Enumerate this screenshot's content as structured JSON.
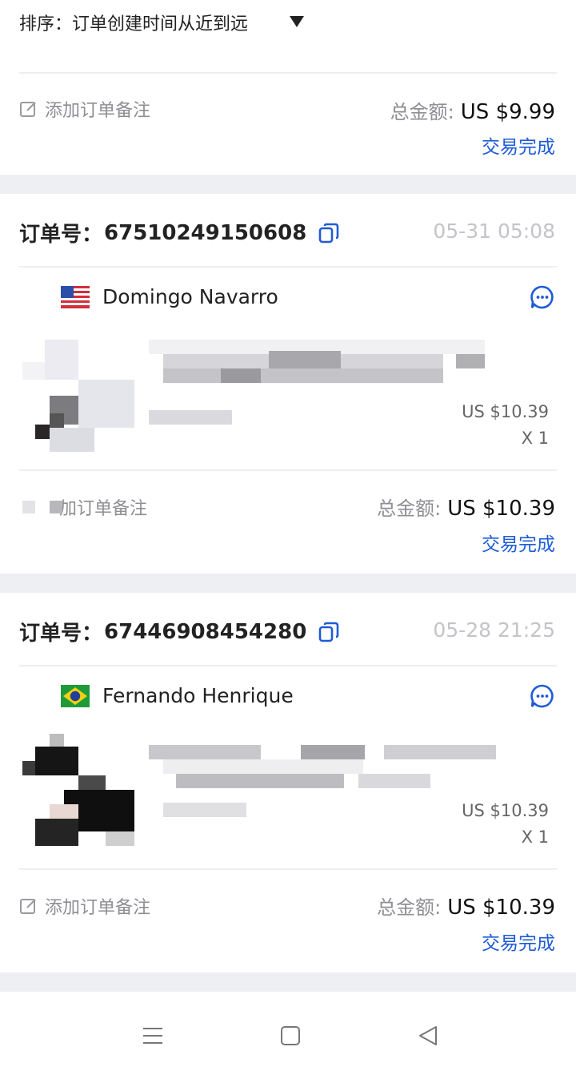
{
  "sort": {
    "label": "排序：订单创建时间从近到远",
    "icon": "caret-down-icon"
  },
  "prev_order": {
    "note_label": "添加订单备注",
    "total_label": "总金额:",
    "total_value": "US $9.99",
    "status": "交易完成"
  },
  "orders": [
    {
      "order_label": "订单号：",
      "order_no": "67510249150608",
      "time": "05-31 05:08",
      "buyer": "Domingo Navarro",
      "flag": "us-flag",
      "price": "US $10.39",
      "qty": "X 1",
      "note_label": "加订单备注",
      "total_label": "总金额:",
      "total_value": "US $10.39",
      "status": "交易完成"
    },
    {
      "order_label": "订单号：",
      "order_no": "67446908454280",
      "time": "05-28 21:25",
      "buyer": "Fernando Henrique",
      "flag": "brazil-flag",
      "price": "US $10.39",
      "qty": "X 1",
      "note_label": "添加订单备注",
      "total_label": "总金额:",
      "total_value": "US $10.39",
      "status": "交易完成"
    }
  ],
  "nav": {
    "menu": "menu-icon",
    "home": "home-icon",
    "back": "back-icon"
  },
  "colors": {
    "accent": "#1f5bd6",
    "separator": "#eeeff2",
    "muted": "#8e8e93"
  }
}
